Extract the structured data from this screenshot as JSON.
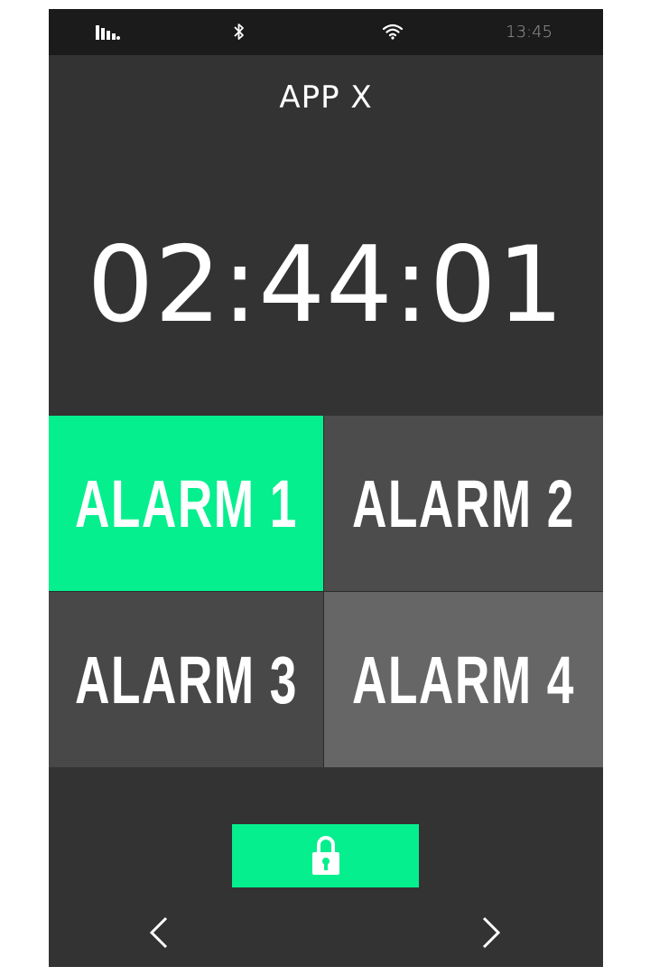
{
  "status_bar": {
    "time": "13:45",
    "icons": [
      "signal-bars-icon",
      "bluetooth-icon",
      "wifi-icon"
    ]
  },
  "app": {
    "title": "APP X"
  },
  "timer": {
    "value": "02:44:01"
  },
  "alarms": [
    {
      "label": "ALARM 1",
      "active": true
    },
    {
      "label": "ALARM 2",
      "active": false
    },
    {
      "label": "ALARM 3",
      "active": false
    },
    {
      "label": "ALARM 4",
      "active": false
    }
  ],
  "controls": {
    "lock_icon": "padlock-unlocked-icon",
    "prev_icon": "chevron-left-icon",
    "next_icon": "chevron-right-icon"
  },
  "colors": {
    "accent": "#05ef8e",
    "background": "#333333",
    "status_bar": "#1b1b1b",
    "tile_dark": "#4c4c4c",
    "tile_light": "#666666",
    "text": "#ffffff",
    "clock_text": "#9a9a9a"
  }
}
